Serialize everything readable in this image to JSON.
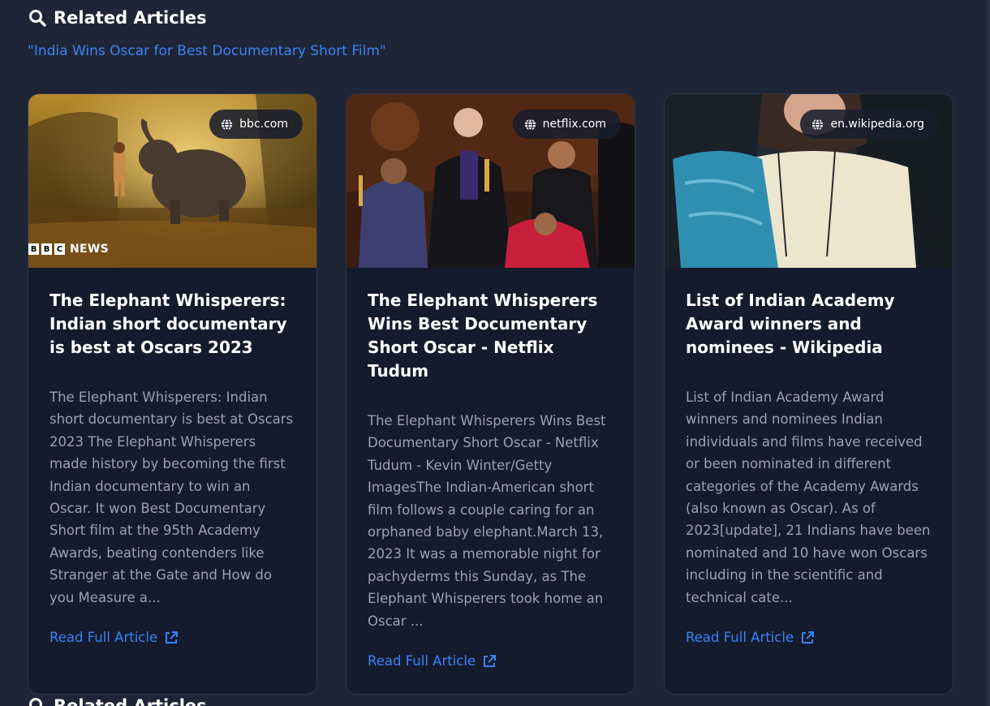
{
  "section": {
    "title": "Related Articles",
    "query": "\"India Wins Oscar for Best Documentary Short Film\""
  },
  "cards": [
    {
      "domain": "bbc.com",
      "image_overlay_text": "BBC NEWS",
      "title": "The Elephant Whisperers: Indian short documentary is best at Oscars 2023",
      "snippet": "The Elephant Whisperers: Indian short documentary is best at Oscars 2023 The Elephant Whisperers made history by becoming the first Indian documentary to win an Oscar. It won Best Documentary Short film at the 95th Academy Awards, beating contenders like Stranger at the Gate and How do you Measure a...",
      "link_label": "Read Full Article"
    },
    {
      "domain": "netflix.com",
      "title": "The Elephant Whisperers Wins Best Documentary Short Oscar - Netflix Tudum",
      "snippet": "The Elephant Whisperers Wins Best Documentary Short Oscar - Netflix Tudum - Kevin Winter/Getty ImagesThe Indian-American short film follows a couple caring for an orphaned baby elephant.March 13, 2023 It was a memorable night for pachyderms this Sunday, as The Elephant Whisperers took home an Oscar ...",
      "link_label": "Read Full Article"
    },
    {
      "domain": "en.wikipedia.org",
      "title": "List of Indian Academy Award winners and nominees - Wikipedia",
      "snippet": "List of Indian Academy Award winners and nominees Indian individuals and films have received or been nominated in different categories of the Academy Awards (also known as Oscar). As of 2023[update], 21 Indians have been nominated and 10 have won Oscars including in the scientific and technical cate...",
      "link_label": "Read Full Article"
    }
  ],
  "next_section": {
    "title": "Related Articles"
  },
  "colors": {
    "background": "#1e2536",
    "card": "#141b2d",
    "accent": "#3b82f6",
    "snippet": "#9aa1b0"
  }
}
